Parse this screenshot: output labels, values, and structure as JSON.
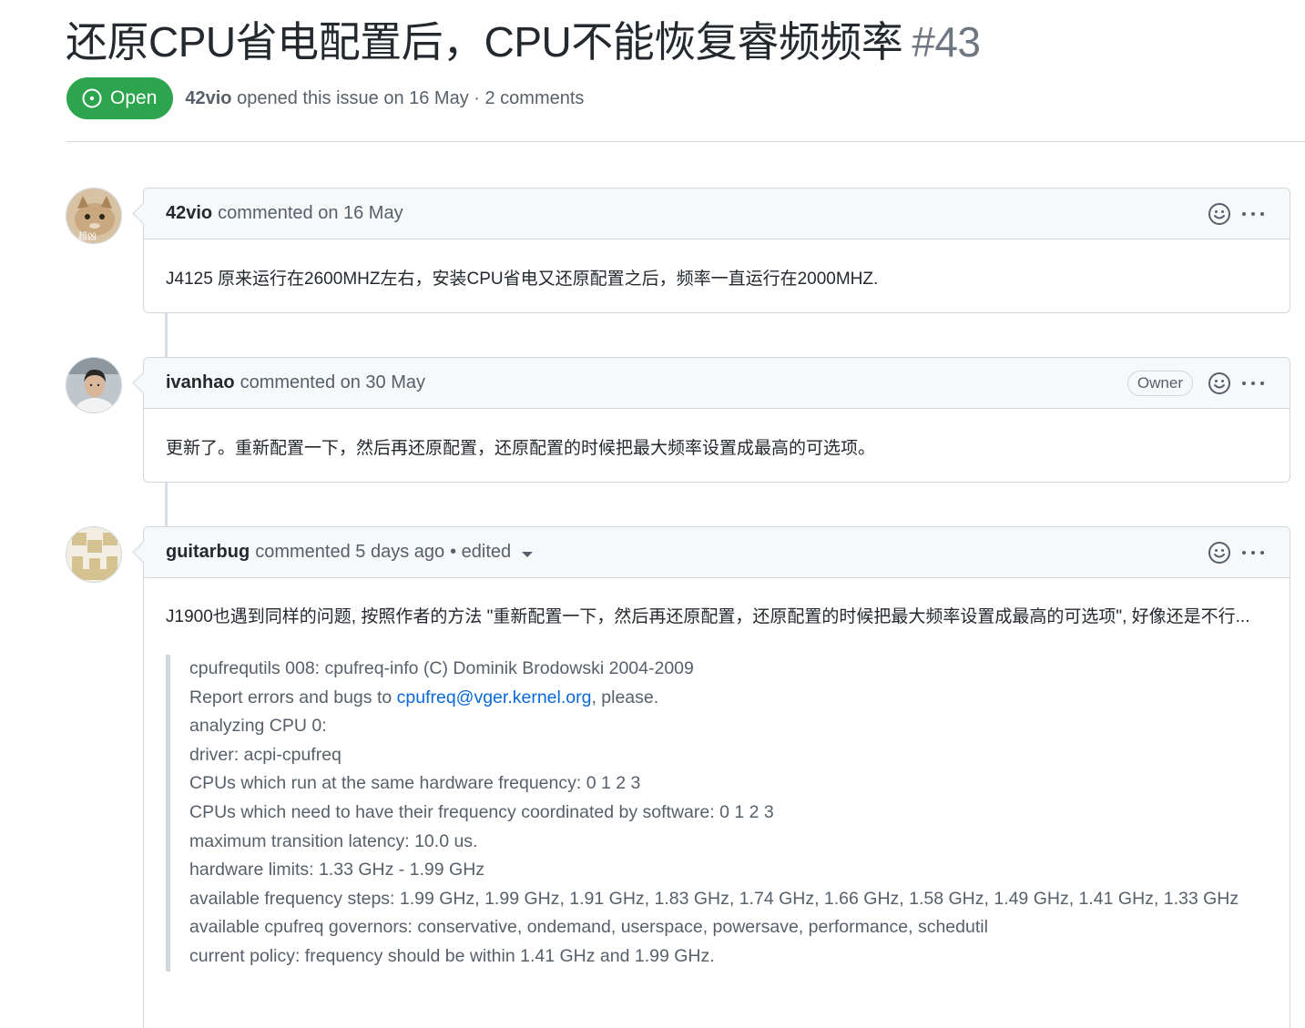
{
  "issue": {
    "title": "还原CPU省电配置后，CPU不能恢复睿频频率",
    "number": "#43",
    "state": "Open",
    "author": "42vio",
    "meta": "opened this issue on 16 May · 2 comments"
  },
  "comments": [
    {
      "author": "42vio",
      "action": "commented on 16 May",
      "avatar_label": "超凶",
      "body": "J4125 原来运行在2600MHZ左右，安装CPU省电又还原配置之后，频率一直运行在2000MHZ."
    },
    {
      "author": "ivanhao",
      "action": "commented on 30 May",
      "badge": "Owner",
      "body": "更新了。重新配置一下，然后再还原配置，还原配置的时候把最大频率设置成最高的可选项。"
    },
    {
      "author": "guitarbug",
      "action": "commented 5 days ago",
      "edited": "• edited",
      "body": "J1900也遇到同样的问题, 按照作者的方法 \"重新配置一下，然后再还原配置，还原配置的时候把最大频率设置成最高的可选项\", 好像还是不行...",
      "quote": {
        "line1": "cpufrequtils 008: cpufreq-info (C) Dominik Brodowski 2004-2009",
        "line2_pre": "Report errors and bugs to ",
        "line2_link": "cpufreq@vger.kernel.org",
        "line2_post": ", please.",
        "line3": "analyzing CPU 0:",
        "line4": "driver: acpi-cpufreq",
        "line5": "CPUs which run at the same hardware frequency: 0 1 2 3",
        "line6": "CPUs which need to have their frequency coordinated by software: 0 1 2 3",
        "line7": "maximum transition latency: 10.0 us.",
        "line8": "hardware limits: 1.33 GHz - 1.99 GHz",
        "line9": "available frequency steps: 1.99 GHz, 1.99 GHz, 1.91 GHz, 1.83 GHz, 1.74 GHz, 1.66 GHz, 1.58 GHz, 1.49 GHz, 1.41 GHz, 1.33 GHz",
        "line10": "available cpufreq governors: conservative, ondemand, userspace, powersave, performance, schedutil",
        "line11": "current policy: frequency should be within 1.41 GHz and 1.99 GHz."
      }
    }
  ],
  "colors": {
    "open_green": "#2da44e",
    "link_blue": "#0969da",
    "border": "#d0d7de",
    "header_bg": "#f6f8fa"
  },
  "icons": [
    "issue-opened-icon",
    "smiley-icon",
    "kebab-icon",
    "caret-down-icon"
  ]
}
